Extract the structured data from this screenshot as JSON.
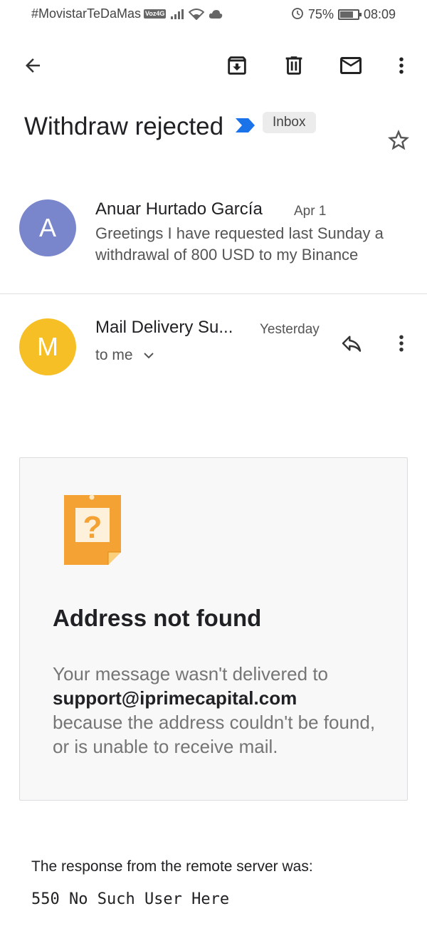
{
  "status_bar": {
    "carrier": "#MovistarTeDaMas",
    "network_badge": "Voz4G",
    "battery": "75%",
    "time": "08:09",
    "icons": [
      "signal-icon",
      "wifi-icon",
      "cloud-icon",
      "alarm-icon",
      "battery-icon"
    ]
  },
  "toolbar": {
    "icons": [
      "back-arrow-icon",
      "archive-icon",
      "delete-icon",
      "mark-unread-icon",
      "more-vert-icon"
    ]
  },
  "thread": {
    "subject": "Withdraw rejected",
    "label": "Inbox",
    "important_color": "#1a73e8"
  },
  "message1": {
    "avatar_letter": "A",
    "avatar_color": "#7986cb",
    "sender": "Anuar Hurtado García",
    "date": "Apr 1",
    "snippet": "Greetings I have requested last Sunday a withdrawal of 800 USD to my Binance"
  },
  "message2": {
    "avatar_letter": "M",
    "avatar_color": "#f6bf26",
    "sender": "Mail Delivery Su...",
    "date": "Yesterday",
    "recipient": "to me"
  },
  "bounce": {
    "title": "Address not found",
    "text_before": "Your message wasn't delivered to",
    "address": "support@iprimecapital.com",
    "text_after": "because the address couldn't be found, or is unable to receive mail."
  },
  "response": {
    "label": "The response from the remote server was:",
    "code": "550 No Such User Here"
  }
}
